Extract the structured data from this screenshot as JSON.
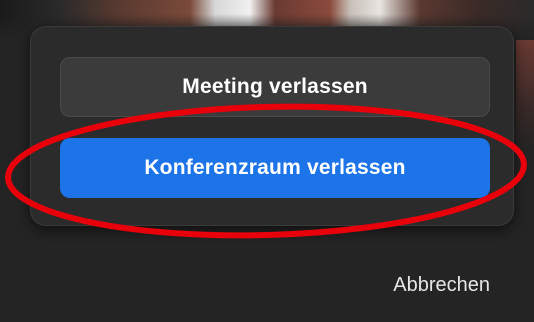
{
  "dialog": {
    "leave_meeting_label": "Meeting verlassen",
    "leave_breakout_room_label": "Konferenzraum verlassen",
    "cancel_label": "Abbrechen"
  },
  "colors": {
    "primary_button": "#1c74e8",
    "secondary_button": "#3b3b3b",
    "annotation": "#e8000a",
    "panel_background": "#2b2b2b"
  },
  "annotation": {
    "shape": "ellipse",
    "highlights": "leave_breakout_room_button"
  }
}
